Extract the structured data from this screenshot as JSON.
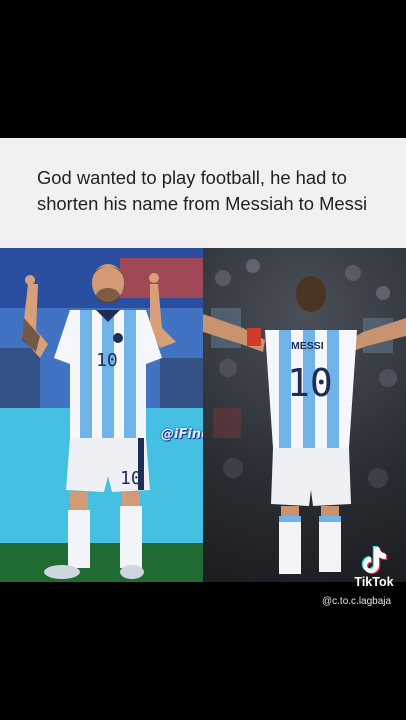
{
  "caption": {
    "text": "God wanted to play football, he had to shorten his name from Messiah to Messi"
  },
  "photo_left": {
    "jersey_number": "10",
    "watermark": "@iFineDieHub"
  },
  "photo_right": {
    "jersey_name": "MESSI",
    "jersey_number": "10"
  },
  "tiktok": {
    "logo_label": "TikTok",
    "handle": "@c.to.c.lagbaja",
    "icon": "tiktok-logo-icon"
  },
  "colors": {
    "background": "#000000",
    "caption_bg": "#f1f1f1",
    "jersey_blue": "#6fb3e8",
    "jersey_white": "#f5f7fb"
  }
}
